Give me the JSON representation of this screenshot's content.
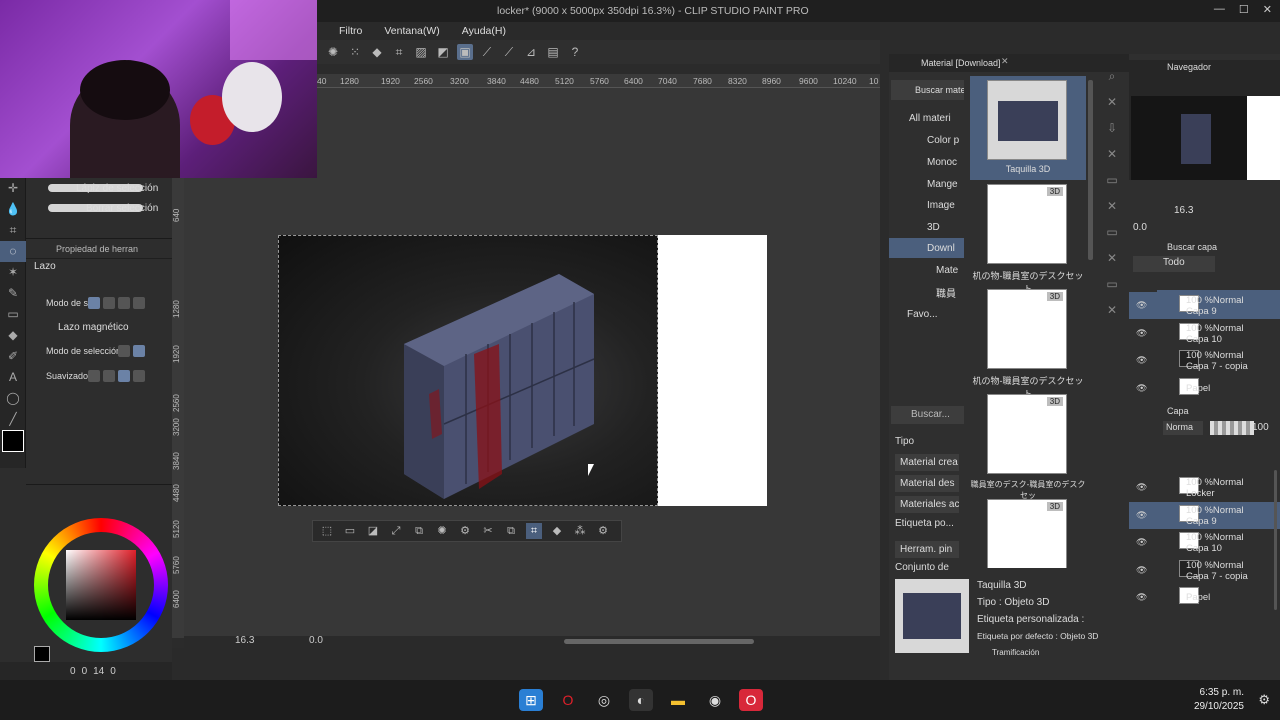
{
  "window": {
    "title": "locker* (9000 x 5000px 350dpi 16.3%) - CLIP STUDIO PAINT PRO",
    "min": "—",
    "max": "☐",
    "close": "✕"
  },
  "menu": [
    "Filtro",
    "Ventana(W)",
    "Ayuda(H)"
  ],
  "ruler_h": [
    "40",
    "1280",
    "1920",
    "2560",
    "3200",
    "3840",
    "4480",
    "5120",
    "5760",
    "6400",
    "7040",
    "7680",
    "8320",
    "8960",
    "9600",
    "10240",
    "10"
  ],
  "ruler_v": [
    "640",
    "1280",
    "1920",
    "2560",
    "3200",
    "3840",
    "4480",
    "5120",
    "5760",
    "6400"
  ],
  "subtool": {
    "items": [
      "Lápiz de selección",
      "Borrar selección"
    ]
  },
  "tool_property": {
    "header": "Propiedad de herran",
    "tool_name": "Lazo",
    "mode_label": "Modo de se",
    "magnetic_label": "Lazo magnético",
    "selection_mode_label": "Modo de selección d",
    "smoothing_label": "Suavizado"
  },
  "left_status": {
    "a": "0",
    "b": "0",
    "c": "14",
    "d": "0"
  },
  "canvas_status": {
    "zoom": "16.3",
    "rotation": "0.0"
  },
  "material": {
    "panel_title": "Material [Download]",
    "search_label": "Buscar materi",
    "tree": [
      "All materi",
      "Color p",
      "Monoc",
      "Mange",
      "Image",
      "3D",
      "Downl",
      "Mate",
      "職員",
      "Favo..."
    ],
    "thumbs": [
      {
        "caption": "Taquilla 3D",
        "badge": ""
      },
      {
        "caption": "机の物-職員室のデスクセット",
        "badge": "3D"
      },
      {
        "caption": "机の物-職員室のデスクセット",
        "badge": "3D"
      },
      {
        "caption": "職員室のデスク-職員室のデスクセッ",
        "badge": "3D"
      },
      {
        "caption": "",
        "badge": "3D"
      }
    ],
    "search2": "Buscar...",
    "type_label": "Tipo",
    "type_items": [
      "Material crea",
      "Material des",
      "Materiales ac",
      "Etiqueta po...",
      "Herram. pin",
      "Conjunto de"
    ],
    "detail": {
      "name": "Taquilla 3D",
      "type": "Tipo : Objeto 3D",
      "custom_tag": "Etiqueta personalizada :",
      "default_tag": "Etiqueta por defecto : Objeto 3D",
      "trim": "Tramificación"
    }
  },
  "navigator": {
    "title": "Navegador",
    "zoom": "16.3",
    "angle": "0.0"
  },
  "layer_search": {
    "label": "Buscar capa",
    "filter": "Todo"
  },
  "layers_top": [
    {
      "pct": "100 %Normal",
      "name": "Capa 9",
      "sel": true,
      "dark": false
    },
    {
      "pct": "100 %Normal",
      "name": "Capa 10",
      "sel": false,
      "dark": false
    },
    {
      "pct": "100 %Normal",
      "name": "Capa 7 - copia",
      "sel": false,
      "dark": true
    },
    {
      "pct": "",
      "name": "Papel",
      "sel": false,
      "dark": false
    }
  ],
  "layer_panel": {
    "title": "Capa",
    "blend": "Norma",
    "opacity": "100"
  },
  "layers_bottom": [
    {
      "pct": "100 %Normal",
      "name": "Locker",
      "sel": false,
      "dark": false,
      "folder": true
    },
    {
      "pct": "100 %Normal",
      "name": "Capa 9",
      "sel": true,
      "dark": false,
      "folder": false
    },
    {
      "pct": "100 %Normal",
      "name": "Capa 10",
      "sel": false,
      "dark": false,
      "folder": false
    },
    {
      "pct": "100 %Normal",
      "name": "Capa 7 - copia",
      "sel": false,
      "dark": true,
      "folder": false
    },
    {
      "pct": "",
      "name": "Papel",
      "sel": false,
      "dark": false,
      "folder": false
    }
  ],
  "taskbar": {
    "time": "6:35 p. m.",
    "date": "29/10/2025"
  },
  "colors": {
    "accent": "#4b5f7d",
    "bg": "#2b2b2b",
    "locker": "#4a5070",
    "blood": "#8a1015"
  }
}
